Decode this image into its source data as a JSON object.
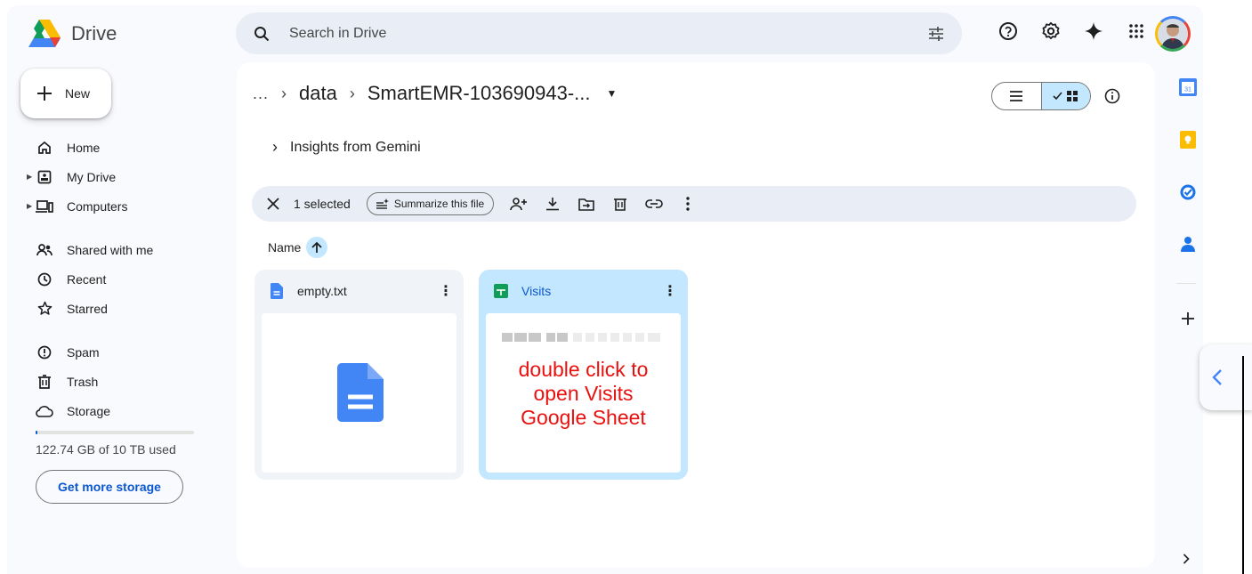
{
  "app": {
    "name": "Drive"
  },
  "search": {
    "placeholder": "Search in Drive"
  },
  "sidebar": {
    "new_label": "New",
    "items": [
      {
        "label": "Home",
        "icon": "home-icon"
      },
      {
        "label": "My Drive",
        "icon": "my-drive-icon"
      },
      {
        "label": "Computers",
        "icon": "computers-icon"
      },
      {
        "label": "Shared with me",
        "icon": "shared-icon"
      },
      {
        "label": "Recent",
        "icon": "clock-icon"
      },
      {
        "label": "Starred",
        "icon": "star-icon"
      },
      {
        "label": "Spam",
        "icon": "spam-icon"
      },
      {
        "label": "Trash",
        "icon": "trash-icon"
      },
      {
        "label": "Storage",
        "icon": "cloud-icon"
      }
    ],
    "storage": {
      "used_text": "122.74 GB of 10 TB used",
      "fraction": 0.012
    },
    "get_storage_label": "Get more storage"
  },
  "breadcrumb": {
    "ellipsis": "...",
    "parent": "data",
    "current": "SmartEMR-103690943-..."
  },
  "insights": {
    "label": "Insights from Gemini"
  },
  "selection": {
    "count_label": "1 selected",
    "summarize_label": "Summarize this file"
  },
  "sort": {
    "label": "Name"
  },
  "files": [
    {
      "name": "empty.txt",
      "type": "document",
      "selected": false
    },
    {
      "name": "Visits",
      "type": "spreadsheet",
      "selected": true
    }
  ],
  "annotation": {
    "lines": [
      "double click to",
      "open Visits",
      "Google Sheet"
    ],
    "color": "#e8110f"
  },
  "colors": {
    "accent": "#0b57d0",
    "selected_bg": "#c2e7ff",
    "surface": "#f8fafd"
  }
}
